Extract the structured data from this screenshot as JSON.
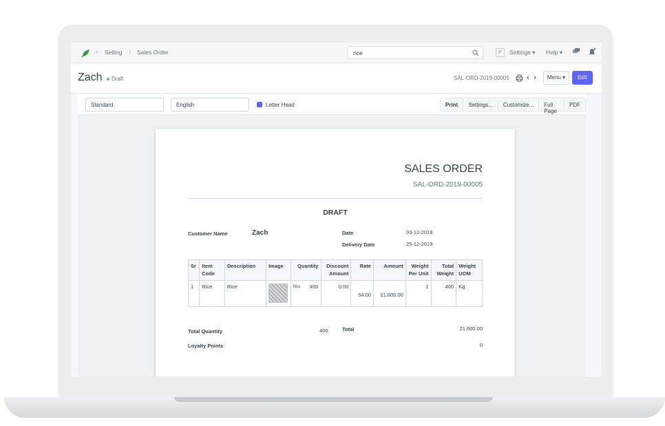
{
  "navbar": {
    "breadcrumbs": [
      "Selling",
      "Sales Order"
    ],
    "search_value": "rice",
    "avatar_initial": "P",
    "settings_label": "Settings",
    "help_label": "Help"
  },
  "page": {
    "title": "Zach",
    "status": "Draft",
    "doc_name": "SAL-ORD-2019-00005",
    "menu_label": "Menu",
    "edit_label": "Edit"
  },
  "toolbar": {
    "print_format": "Standard",
    "language": "English",
    "letter_head_label": "Letter Head",
    "letter_head_checked": true,
    "buttons": [
      "Print",
      "Settings...",
      "Customize...",
      "Full Page",
      "PDF"
    ]
  },
  "document": {
    "heading": "SALES ORDER",
    "doc_number": "SAL-ORD-2019-00005",
    "draft_label": "DRAFT",
    "customer_name_label": "Customer Name",
    "customer_name": "Zach",
    "date_label": "Date",
    "date": "03-12-2019",
    "delivery_date_label": "Delivery Date",
    "delivery_date": "25-12-2019",
    "columns": {
      "sr": "Sr",
      "item_code": "Item Code",
      "description": "Description",
      "image": "Image",
      "quantity": "Quantity",
      "discount": "Discount Amount",
      "rate": "Rate",
      "amount": "Amount",
      "weight_per_unit": "Weight Per Unit",
      "total_weight": "Total Weight",
      "weight_uom": "Weight UOM"
    },
    "rows": [
      {
        "sr": "1",
        "item_code": "Rice",
        "description": "Rice",
        "uom": "Nos",
        "quantity": "400",
        "discount": "0.00",
        "rate": "54.00",
        "amount": "21,600.00",
        "weight_per_unit": "1",
        "total_weight": "400",
        "weight_uom": "Kg"
      }
    ],
    "total_quantity_label": "Total Quantity",
    "total_quantity": "400",
    "total_label": "Total",
    "total": "21,600.00",
    "loyalty_points_label": "Loyalty Points",
    "loyalty_points": "0"
  },
  "colors": {
    "primary": "#5e64ff",
    "text": "#36414c",
    "muted": "#6c7680"
  }
}
